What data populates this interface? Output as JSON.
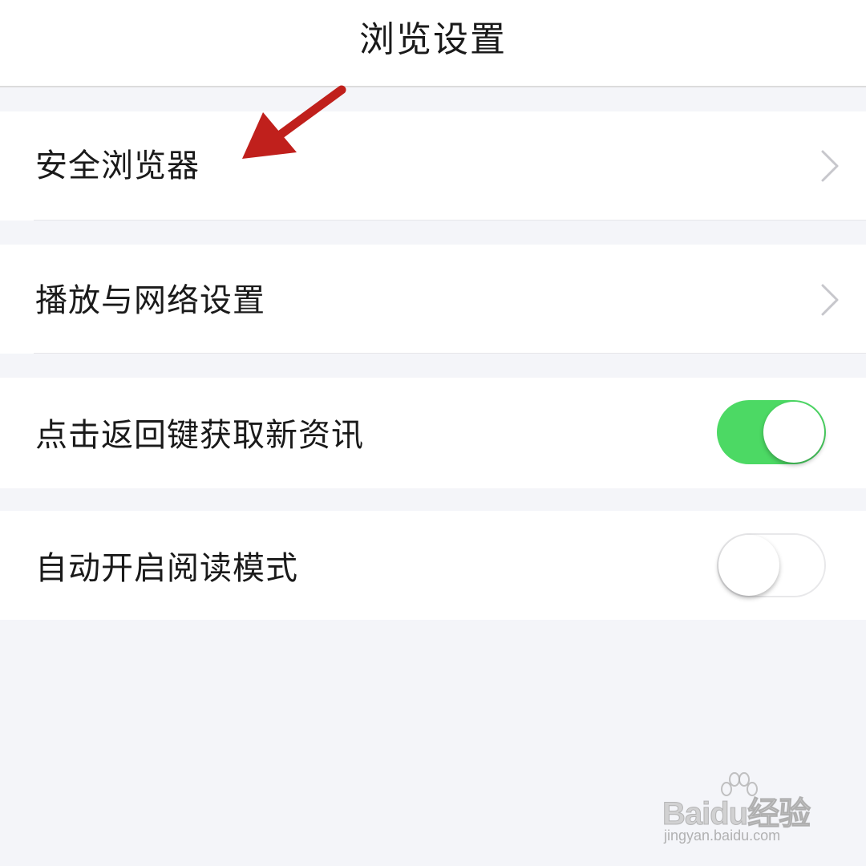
{
  "header": {
    "title": "浏览设置"
  },
  "settings": [
    {
      "label": "安全浏览器",
      "control": "chevron"
    },
    {
      "label": "播放与网络设置",
      "control": "chevron"
    },
    {
      "label": "点击返回键获取新资讯",
      "control": "toggle",
      "enabled": true
    },
    {
      "label": "自动开启阅读模式",
      "control": "toggle",
      "enabled": false
    }
  ],
  "icons": {
    "chevron": "chevron-right-icon",
    "annotation": "red-arrow-icon"
  },
  "colors": {
    "toggle_on": "#4cd964",
    "annotation_arrow": "#c0201c",
    "background": "#f4f5f9"
  },
  "watermark": {
    "brand": "Baidu经验",
    "url": "jingyan.baidu.com"
  }
}
